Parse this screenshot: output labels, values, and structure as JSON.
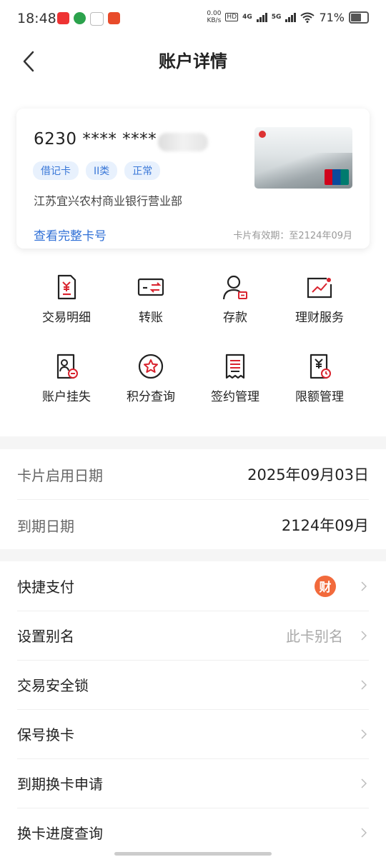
{
  "status": {
    "time": "18:48",
    "net_speed_top": "0.00",
    "net_speed_unit": "KB/s",
    "hd": "HD",
    "sim1": "4G",
    "sim2": "5G",
    "battery": "71%"
  },
  "header": {
    "title": "账户详情"
  },
  "card": {
    "number": "6230 **** ****",
    "tags": [
      "借记卡",
      "II类",
      "正常"
    ],
    "branch": "江苏宜兴农村商业银行营业部",
    "view_full": "查看完整卡号",
    "expiry_note": "卡片有效期：至2124年09月"
  },
  "grid": [
    {
      "label": "交易明细",
      "icon": "transaction-detail-icon"
    },
    {
      "label": "转账",
      "icon": "transfer-icon"
    },
    {
      "label": "存款",
      "icon": "deposit-icon"
    },
    {
      "label": "理财服务",
      "icon": "wealth-icon"
    },
    {
      "label": "账户挂失",
      "icon": "report-loss-icon"
    },
    {
      "label": "积分查询",
      "icon": "points-icon"
    },
    {
      "label": "签约管理",
      "icon": "contract-icon"
    },
    {
      "label": "限额管理",
      "icon": "limit-icon"
    }
  ],
  "info": {
    "activation_label": "卡片启用日期",
    "activation_value": "2025年09月03日",
    "expiry_label": "到期日期",
    "expiry_value": "2124年09月"
  },
  "settings": {
    "quick_pay": "快捷支付",
    "quick_pay_badge": "财",
    "alias": "设置别名",
    "alias_value": "此卡别名",
    "security_lock": "交易安全锁",
    "keep_number": "保号换卡",
    "expiry_replace": "到期换卡申请",
    "replace_progress": "换卡进度查询"
  },
  "colors": {
    "accent": "#2f6fd6",
    "icon_red": "#d9232e",
    "badge": "#f26a3c"
  }
}
